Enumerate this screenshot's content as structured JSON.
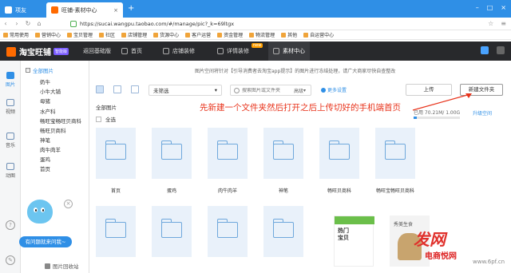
{
  "browser": {
    "tabs": [
      {
        "label": "项友"
      },
      {
        "label": "旺铺-素材中心"
      }
    ],
    "url": "https://sucai.wangpu.taobao.com/#/manage/pic?_k=69ltgx",
    "bookmarks": [
      "常用使用",
      "营销中心",
      "宝贝管理",
      "社区",
      "店铺管理",
      "货源中心",
      "客户运营",
      "资金管理",
      "物流管理",
      "其他",
      "自运营中心"
    ]
  },
  "header": {
    "logo": "淘宝旺铺",
    "edition_badge": "智能版",
    "back_link": "返回基础版",
    "nav": [
      "首页",
      "店铺装修",
      "详情装修",
      "素材中心"
    ],
    "new_tag": "new"
  },
  "rail": {
    "items": [
      "图片",
      "视频",
      "音乐",
      "动图"
    ]
  },
  "tree": {
    "root": "全部图片",
    "items": [
      "奶牛",
      "小牛大铺",
      "母猪",
      "水产科",
      "畅旺宝畅旺贝商科",
      "畅旺贝商科",
      "神笔",
      "肉牛肉羊",
      "蛋鸡",
      "首页"
    ],
    "recycle": "图片回收站"
  },
  "help": {
    "bubble": "有问题就来问我~"
  },
  "notice": "图片空间将针对【引导消费者去淘宝app提示】的图片进行冻结处理，请广大商家尽快自查整改",
  "toolbar": {
    "filter_value": "未筛选",
    "search_placeholder": "搜索图片或文件夹",
    "advanced": "高级",
    "more_settings": "更多设置",
    "upload": "上传",
    "new_folder": "新建文件夹"
  },
  "storage": {
    "used_text": "已用 70.21M/ 1.00G",
    "used_fraction": 0.07,
    "upgrade": "升级空间"
  },
  "annotation": "先新建一个文件夹然后打开之后上传切好的手机端首页",
  "crumb": "全部图片",
  "select_all": "全选",
  "folders_row1": [
    "首页",
    "蛋鸡",
    "肉牛肉羊",
    "神笔",
    "畅旺贝商科",
    "畅旺宝畅旺贝商科"
  ],
  "thumb_texts": {
    "t1": "热门\n宝贝",
    "t2": "秀美生食"
  },
  "watermark": {
    "big": "发网",
    "small": "电商悦网",
    "site": "www.6pf.cn"
  }
}
